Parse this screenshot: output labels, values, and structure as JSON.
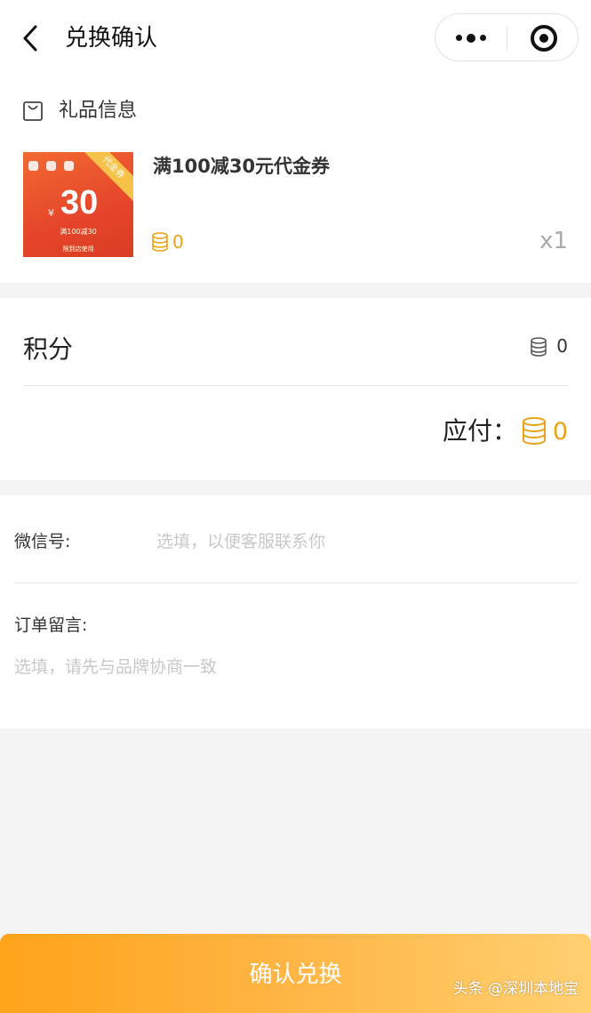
{
  "nav": {
    "title": "兑换确认"
  },
  "gift": {
    "section_label": "礼品信息",
    "name": "满100减30元代金券",
    "points": "0",
    "quantity": "x1",
    "voucher": {
      "corner_text": "代金券",
      "yen": "¥",
      "amount": "30",
      "sub": "满100减30",
      "foot": "限到店使用"
    }
  },
  "points": {
    "label": "积分",
    "value": "0",
    "payable_label": "应付：",
    "payable_value": "0"
  },
  "form": {
    "wechat_label": "微信号:",
    "wechat_placeholder": "选填，以便客服联系你",
    "note_label": "订单留言:",
    "note_placeholder": "选填，请先与品牌协商一致"
  },
  "footer": {
    "confirm_label": "确认兑换",
    "watermark": "头条 @深圳本地宝"
  },
  "colors": {
    "accent": "#e8a317",
    "button_start": "#ffa31a",
    "button_end": "#ffd070"
  },
  "icons": [
    "back-arrow-icon",
    "more-dots-icon",
    "close-target-icon",
    "gift-bag-icon",
    "coin-stack-icon"
  ]
}
